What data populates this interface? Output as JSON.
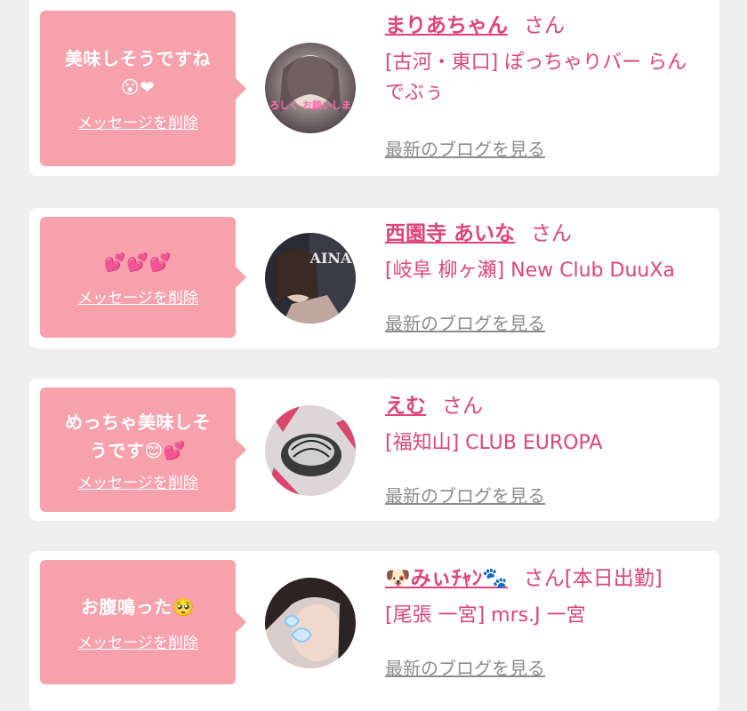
{
  "messages": [
    {
      "bubble_line1": "美味しそうですね",
      "bubble_line2": "😮❤",
      "delete_label": "メッセージを削除",
      "cast_name": "まりあちゃん",
      "honorific": "さん",
      "shop": "[古河・東口] ぽっちゃりバー らんでぶぅ",
      "blog_label": "最新のブログを見る",
      "avatar_text": "よろしく お願いします"
    },
    {
      "bubble_line1": "💕💕💕",
      "delete_label": "メッセージを削除",
      "cast_name": "西園寺 あいな",
      "honorific": "さん",
      "shop": "[岐阜 柳ヶ瀬] New Club DuuXa",
      "blog_label": "最新のブログを見る",
      "avatar_text": "AINA"
    },
    {
      "bubble_line1": "めっちゃ美味しそ",
      "bubble_line2": "うです😊💕",
      "delete_label": "メッセージを削除",
      "cast_name": "えむ",
      "honorific": "さん",
      "shop": "[福知山] CLUB EUROPA",
      "blog_label": "最新のブログを見る"
    },
    {
      "bubble_line1": "お腹鳴った🥺",
      "delete_label": "メッセージを削除",
      "cast_name": "🐶みぃﾁｬﾝ🐾",
      "honorific": "さん[本日出勤]",
      "shop": "[尾張 一宮] mrs.J 一宮",
      "blog_label": "最新のブログを見る"
    }
  ],
  "colors": {
    "accent": "#e0437a",
    "bubble": "#f7a1ad",
    "link_gray": "#8c8c8c",
    "background": "#efefef"
  }
}
